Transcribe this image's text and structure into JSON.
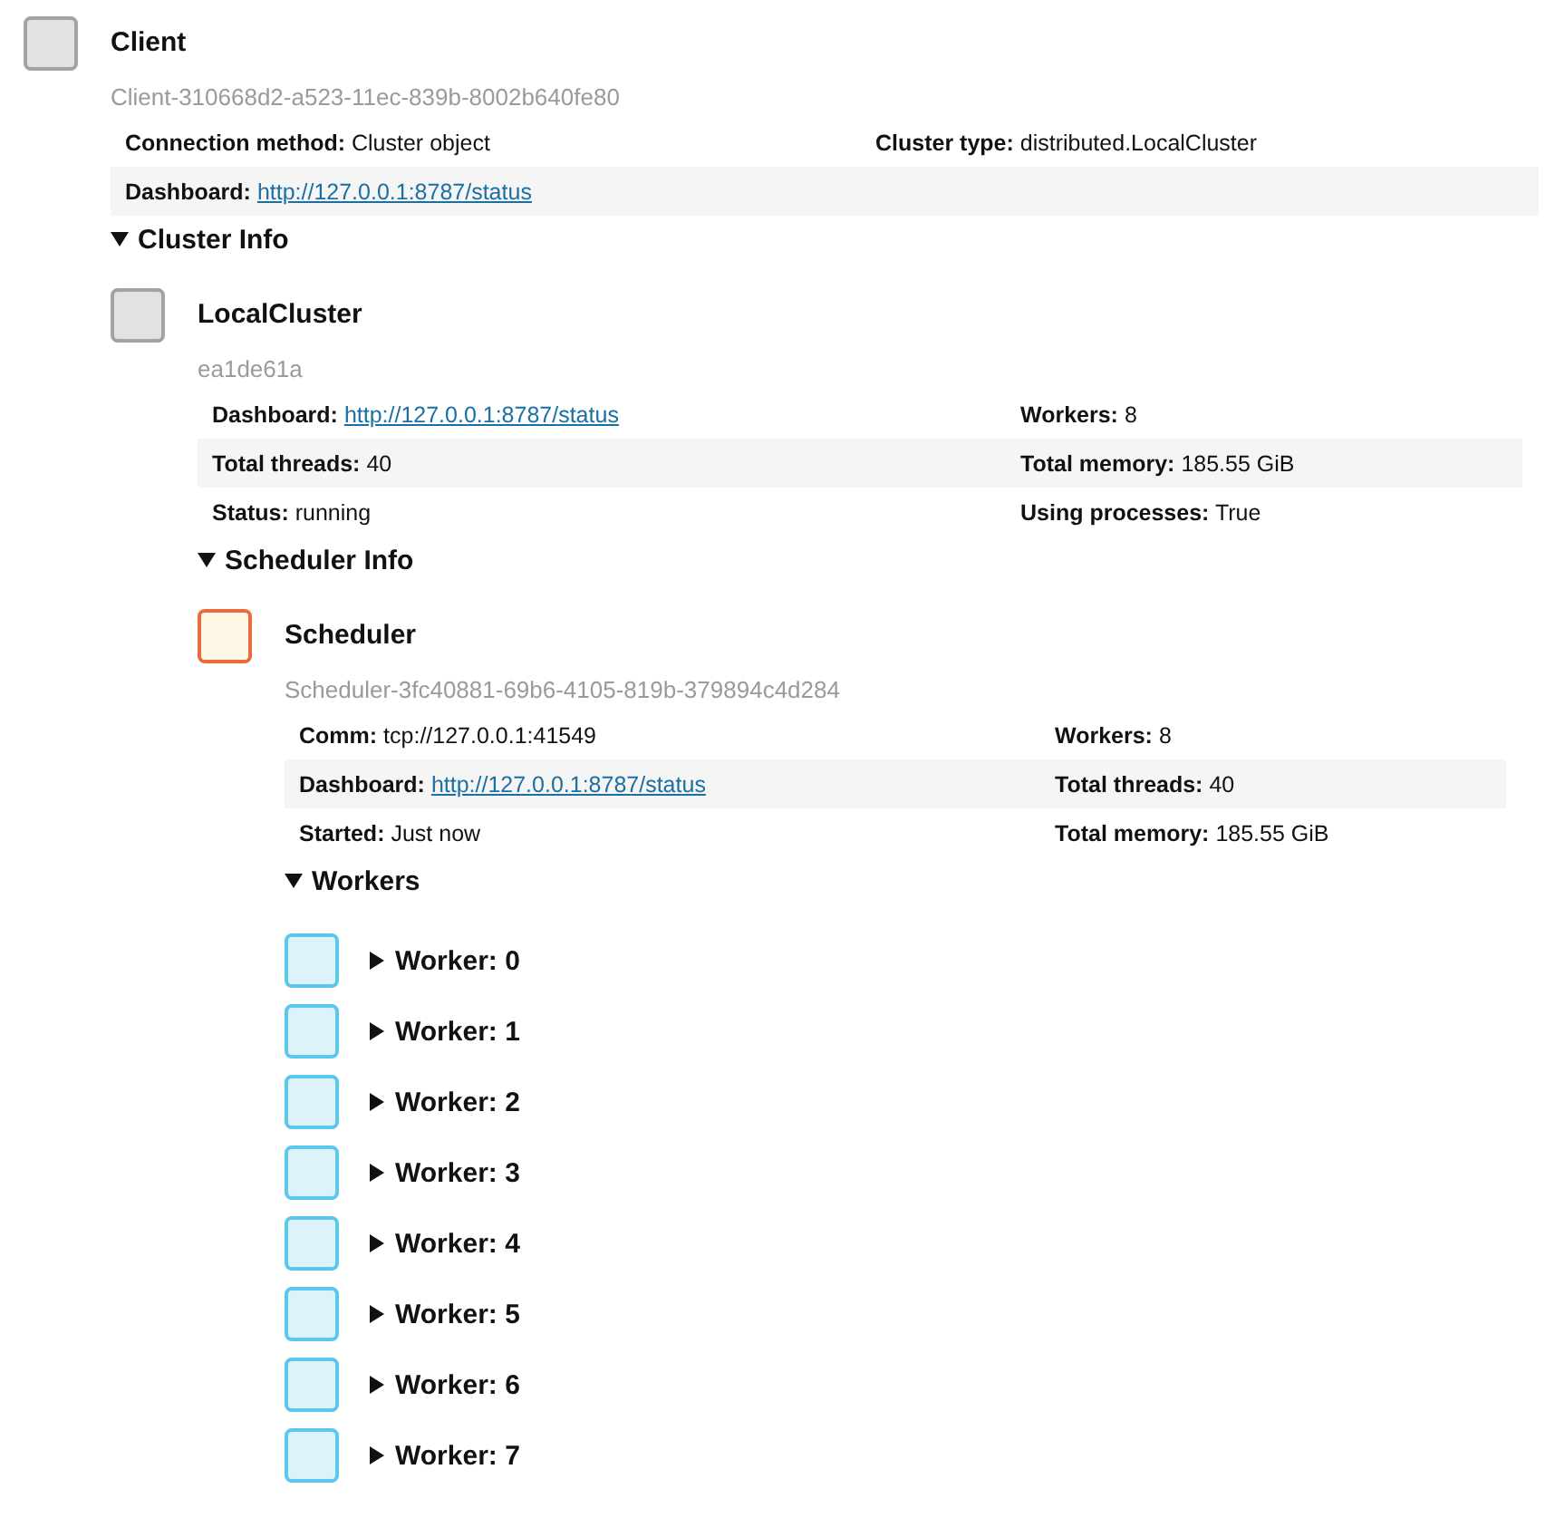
{
  "root": {
    "kind": "client",
    "title": "Client",
    "id": "Client-310668d2-a523-11ec-839b-8002b640fe80",
    "rows": [
      [
        {
          "label": "Connection method:",
          "value": "Cluster object"
        },
        {
          "label": "Cluster type:",
          "value": "distributed.LocalCluster"
        }
      ],
      [
        {
          "label": "Dashboard:",
          "value": "http://127.0.0.1:8787/status",
          "link": true
        }
      ]
    ],
    "details": {
      "summary": "Cluster Info",
      "expanded": true,
      "children": [
        {
          "kind": "cluster",
          "title": "LocalCluster",
          "id": "ea1de61a",
          "rows": [
            [
              {
                "label": "Dashboard:",
                "value": "http://127.0.0.1:8787/status",
                "link": true
              },
              {
                "label": "Workers:",
                "value": "8"
              }
            ],
            [
              {
                "label": "Total threads:",
                "value": "40"
              },
              {
                "label": "Total memory:",
                "value": "185.55 GiB"
              }
            ],
            [
              {
                "label": "Status:",
                "value": "running"
              },
              {
                "label": "Using processes:",
                "value": "True"
              }
            ]
          ],
          "details": {
            "summary": "Scheduler Info",
            "expanded": true,
            "children": [
              {
                "kind": "scheduler",
                "title": "Scheduler",
                "id": "Scheduler-3fc40881-69b6-4105-819b-379894c4d284",
                "rows": [
                  [
                    {
                      "label": "Comm:",
                      "value": "tcp://127.0.0.1:41549"
                    },
                    {
                      "label": "Workers:",
                      "value": "8"
                    }
                  ],
                  [
                    {
                      "label": "Dashboard:",
                      "value": "http://127.0.0.1:8787/status",
                      "link": true
                    },
                    {
                      "label": "Total threads:",
                      "value": "40"
                    }
                  ],
                  [
                    {
                      "label": "Started:",
                      "value": "Just now"
                    },
                    {
                      "label": "Total memory:",
                      "value": "185.55 GiB"
                    }
                  ]
                ],
                "details": {
                  "summary": "Workers",
                  "expanded": true,
                  "children": [
                    {
                      "kind": "worker",
                      "details": {
                        "summary": "Worker: 0",
                        "expanded": false
                      }
                    },
                    {
                      "kind": "worker",
                      "details": {
                        "summary": "Worker: 1",
                        "expanded": false
                      }
                    },
                    {
                      "kind": "worker",
                      "details": {
                        "summary": "Worker: 2",
                        "expanded": false
                      }
                    },
                    {
                      "kind": "worker",
                      "details": {
                        "summary": "Worker: 3",
                        "expanded": false
                      }
                    },
                    {
                      "kind": "worker",
                      "details": {
                        "summary": "Worker: 4",
                        "expanded": false
                      }
                    },
                    {
                      "kind": "worker",
                      "details": {
                        "summary": "Worker: 5",
                        "expanded": false
                      }
                    },
                    {
                      "kind": "worker",
                      "details": {
                        "summary": "Worker: 6",
                        "expanded": false
                      }
                    },
                    {
                      "kind": "worker",
                      "details": {
                        "summary": "Worker: 7",
                        "expanded": false
                      }
                    }
                  ]
                }
              }
            ]
          }
        }
      ]
    }
  }
}
